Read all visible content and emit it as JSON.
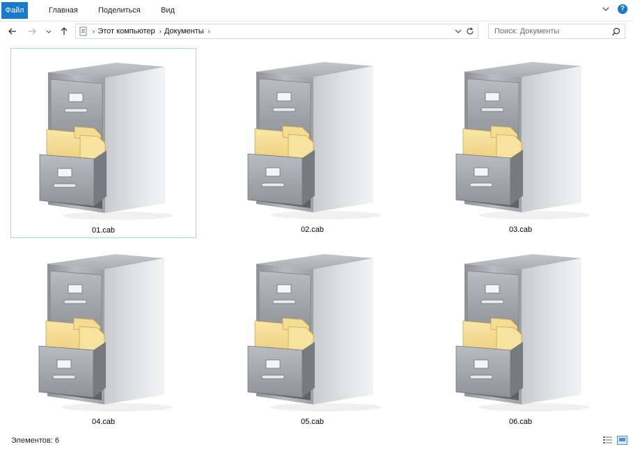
{
  "ribbon": {
    "tabs": [
      {
        "label": "Файл"
      },
      {
        "label": "Главная"
      },
      {
        "label": "Поделиться"
      },
      {
        "label": "Вид"
      }
    ],
    "help_label": "?"
  },
  "address": {
    "crumbs": [
      "Этот компьютер",
      "Документы"
    ]
  },
  "search": {
    "placeholder": "Поиск: Документы"
  },
  "files": [
    {
      "name": "01.cab",
      "icon": "file-cabinet-icon",
      "selected": true
    },
    {
      "name": "02.cab",
      "icon": "file-cabinet-icon",
      "selected": false
    },
    {
      "name": "03.cab",
      "icon": "file-cabinet-icon",
      "selected": false
    },
    {
      "name": "04.cab",
      "icon": "file-cabinet-icon",
      "selected": false
    },
    {
      "name": "05.cab",
      "icon": "file-cabinet-icon",
      "selected": false
    },
    {
      "name": "06.cab",
      "icon": "file-cabinet-icon",
      "selected": false
    }
  ],
  "status": {
    "item_count": "Элементов: 6"
  },
  "colors": {
    "accent": "#1979ca",
    "selection_border": "#99d1ff"
  }
}
